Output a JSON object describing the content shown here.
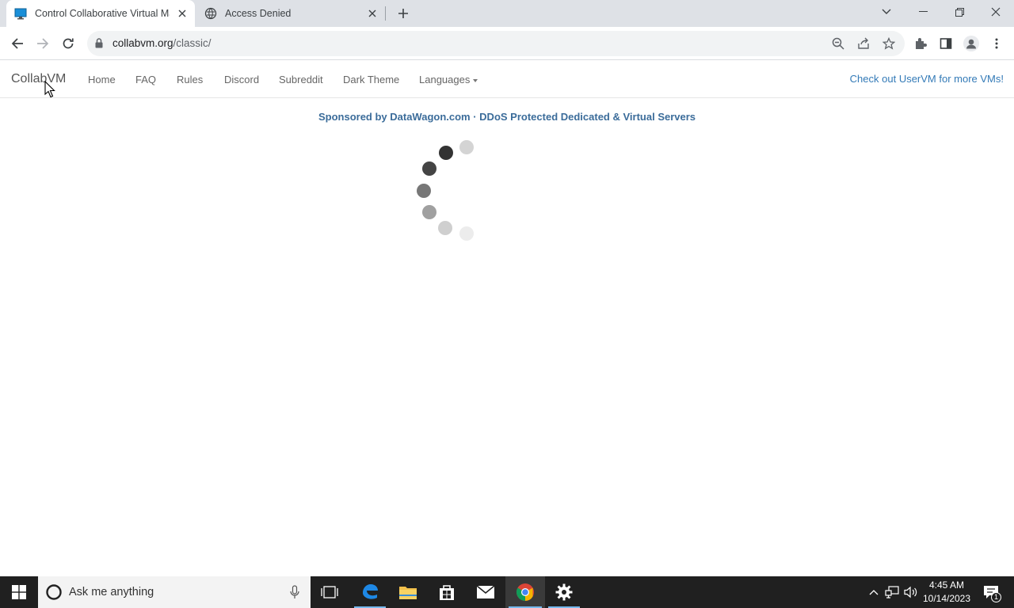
{
  "browser": {
    "tabs": [
      {
        "title": "Control Collaborative Virtual Ma",
        "active": true
      },
      {
        "title": "Access Denied",
        "active": false
      }
    ],
    "url_host": "collabvm.org",
    "url_path": "/classic/"
  },
  "site": {
    "brand": "CollabVM",
    "nav": [
      "Home",
      "FAQ",
      "Rules",
      "Discord",
      "Subreddit",
      "Dark Theme",
      "Languages"
    ],
    "right_link": "Check out UserVM for more VMs!",
    "sponsor": "Sponsored by DataWagon.com · DDoS Protected Dedicated & Virtual Servers"
  },
  "loading_spinner": {
    "state": "loading"
  },
  "taskbar": {
    "search_placeholder": "Ask me anything",
    "time": "4:45 AM",
    "date": "10/14/2023",
    "notification_count": "1",
    "apps": [
      "edge-icon",
      "file-explorer-icon",
      "store-icon",
      "mail-icon",
      "chrome-icon",
      "settings-icon"
    ]
  },
  "colors": {
    "link": "#337ab7",
    "sponsor": "#3b6c9a",
    "taskbar": "#202020",
    "tabstrip": "#dee1e6"
  }
}
